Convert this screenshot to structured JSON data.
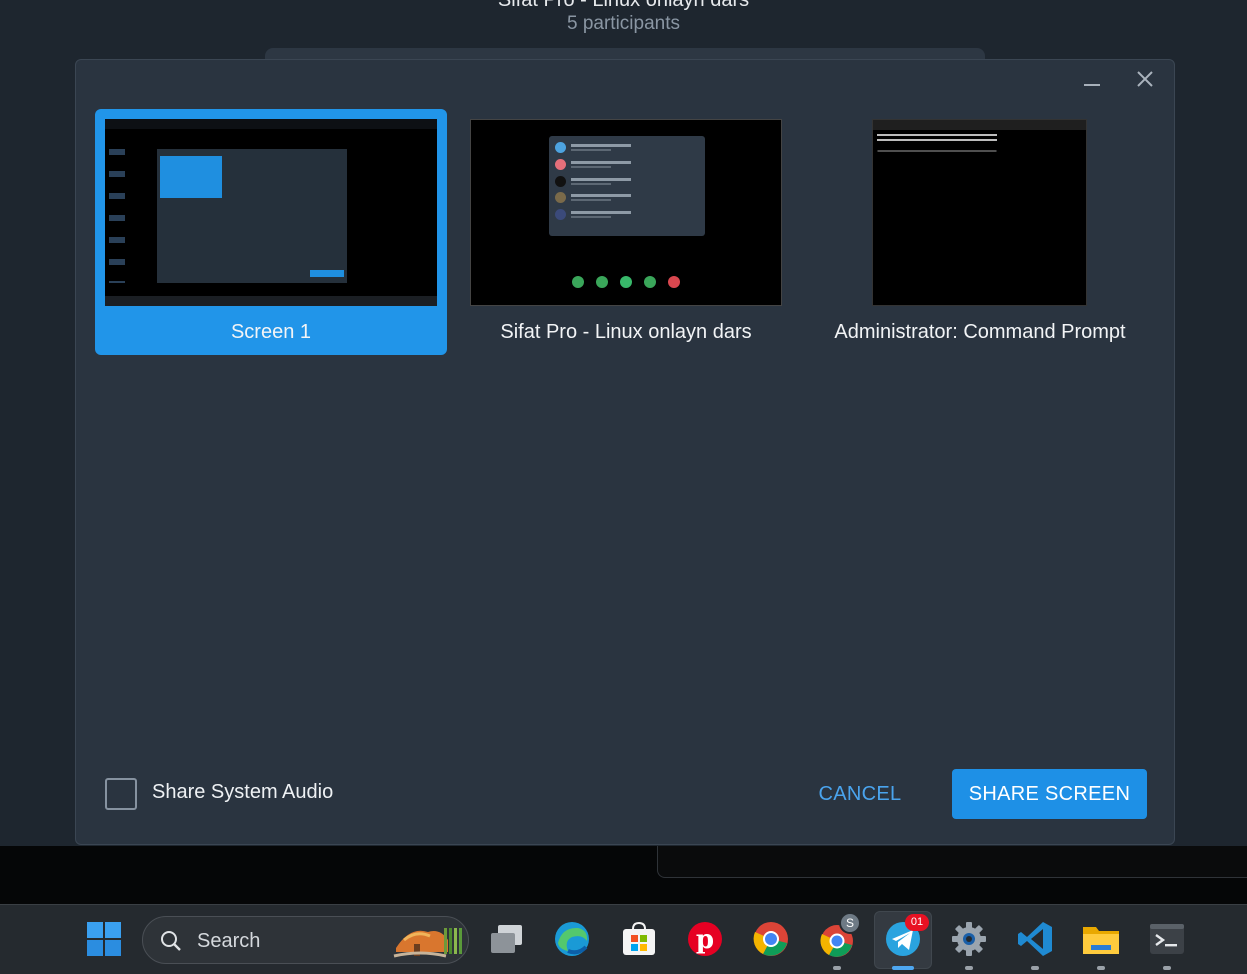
{
  "call": {
    "title": "Sifat Pro - Linux onlayn dars",
    "subtitle": "5 participants"
  },
  "dialog": {
    "sources": [
      {
        "label": "Screen 1",
        "selected": true
      },
      {
        "label": "Sifat Pro - Linux onlayn dars",
        "selected": false
      },
      {
        "label": "Administrator: Command Prompt",
        "selected": false
      }
    ],
    "share_audio_label": "Share System Audio",
    "share_audio_checked": false,
    "cancel_label": "CANCEL",
    "share_label": "SHARE SCREEN"
  },
  "colors": {
    "accent": "#2195e9",
    "dialog_bg": "#2a3440"
  },
  "taskbar": {
    "search_placeholder": "Search",
    "telegram_badge": "01",
    "chrome_profile_badge": "S",
    "apps": [
      "start-icon",
      "task-view-icon",
      "edge-icon",
      "store-icon",
      "pinterest-icon",
      "chrome-icon",
      "chrome-profile-icon",
      "telegram-icon",
      "settings-icon",
      "vscode-icon",
      "file-explorer-icon",
      "terminal-icon"
    ]
  }
}
